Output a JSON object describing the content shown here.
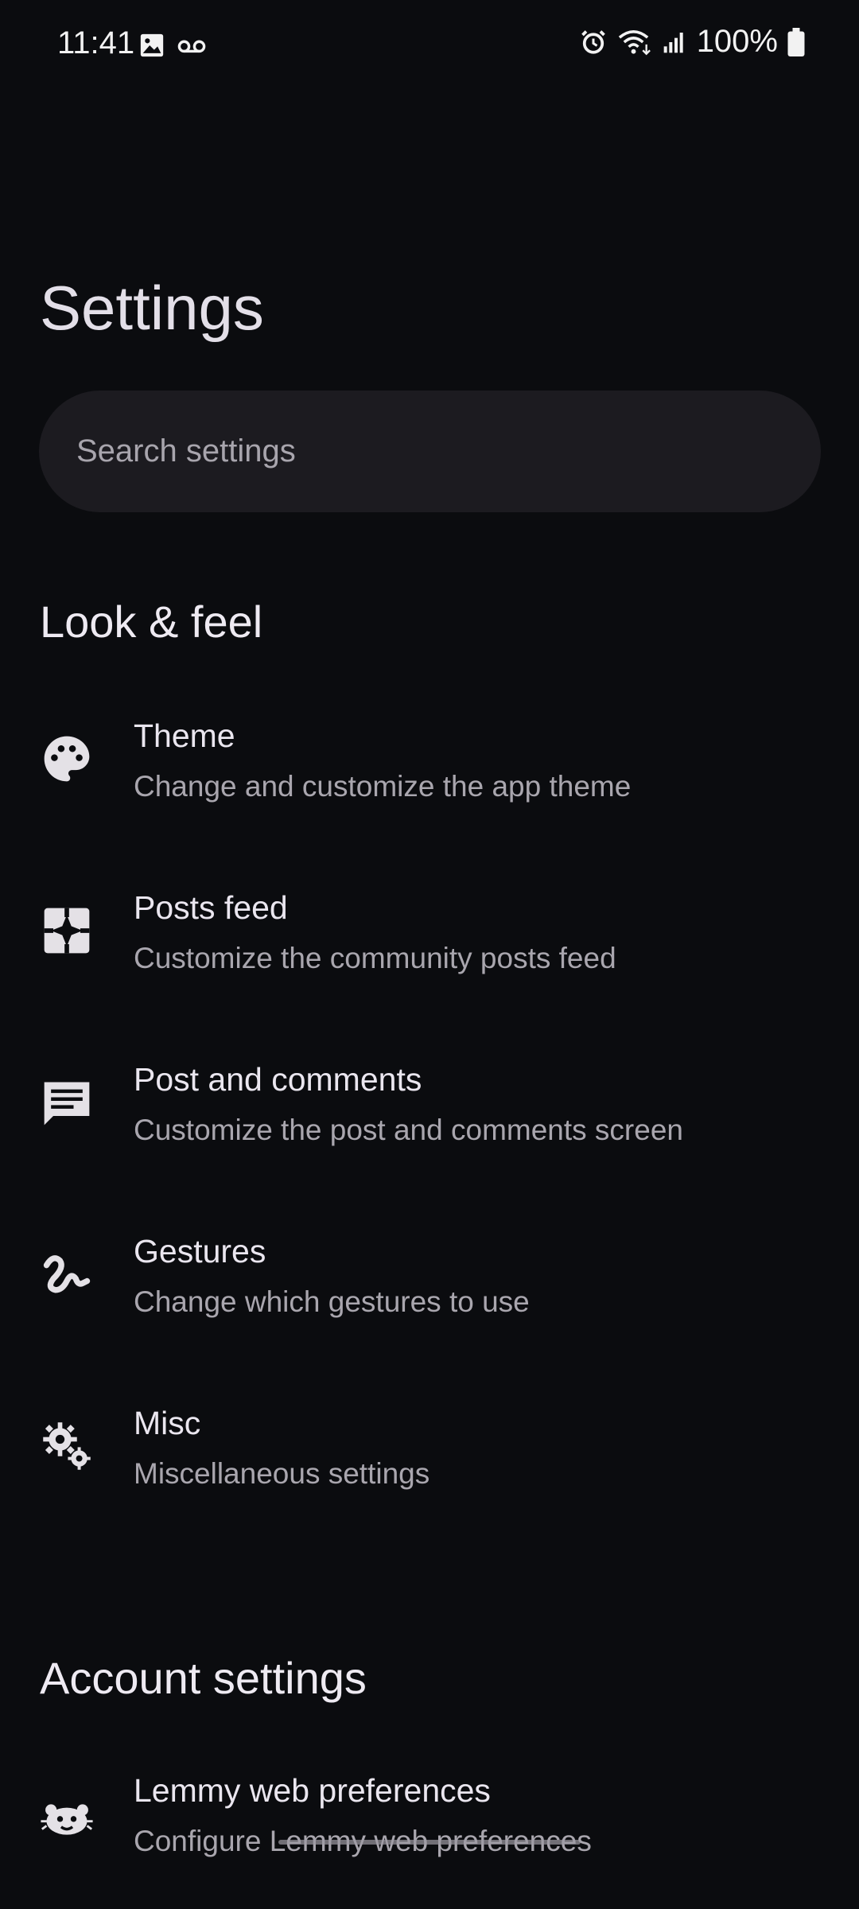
{
  "status_bar": {
    "time": "11:41",
    "battery": "100%"
  },
  "page": {
    "title": "Settings"
  },
  "search": {
    "placeholder": "Search settings"
  },
  "sections": [
    {
      "header": "Look & feel",
      "items": [
        {
          "title": "Theme",
          "description": "Change and customize the app theme",
          "icon": "palette-icon"
        },
        {
          "title": "Posts feed",
          "description": "Customize the community posts feed",
          "icon": "feed-icon"
        },
        {
          "title": "Post and comments",
          "description": "Customize the post and comments screen",
          "icon": "comment-icon"
        },
        {
          "title": "Gestures",
          "description": "Change which gestures to use",
          "icon": "gesture-icon"
        },
        {
          "title": "Misc",
          "description": "Miscellaneous settings",
          "icon": "gears-icon"
        }
      ]
    },
    {
      "header": "Account settings",
      "items": [
        {
          "title": "Lemmy web preferences",
          "description": "Configure Lemmy web preferences",
          "icon": "lemmy-icon"
        }
      ]
    }
  ],
  "colors": {
    "background": "#0b0c0f",
    "surface": "#1c1b20",
    "text": "#e4e1e6",
    "secondary_text": "#a9a6ae"
  }
}
